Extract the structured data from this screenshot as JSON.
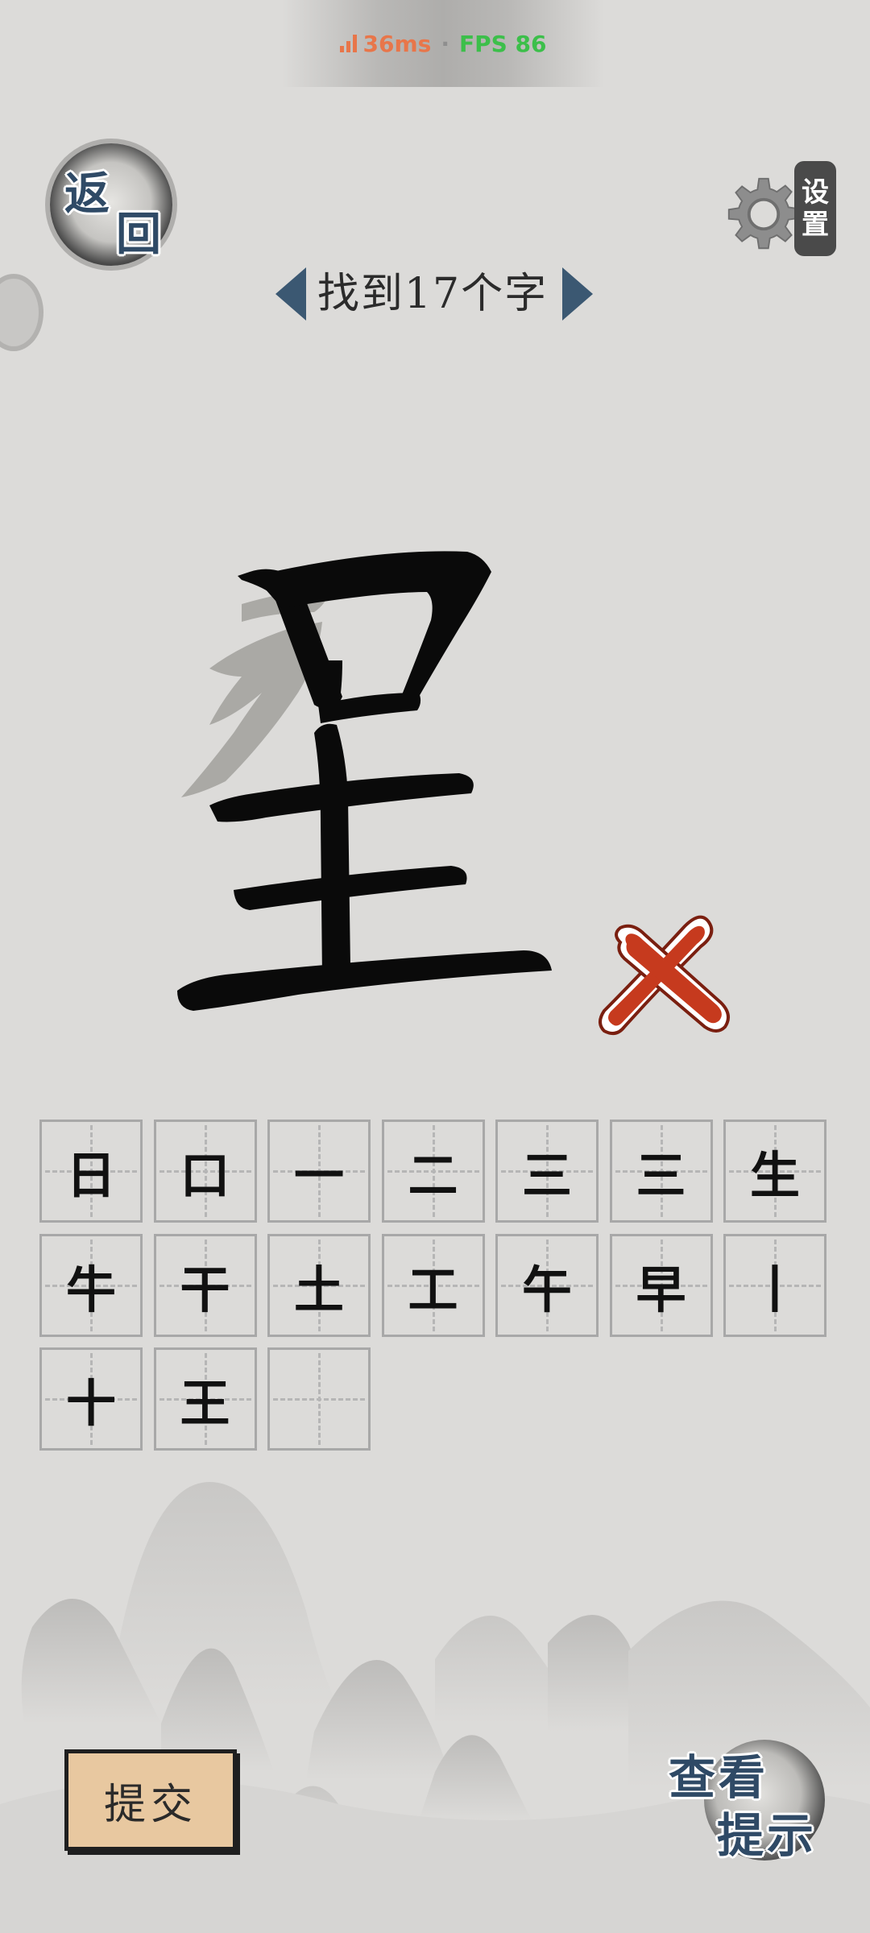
{
  "status_bar": {
    "latency": "36ms",
    "separator": "·",
    "fps": "FPS 86"
  },
  "back_button": {
    "line1": "返",
    "line2": "回"
  },
  "settings_button": {
    "line1": "设",
    "line2": "置"
  },
  "title": "找到17个字",
  "target_character": "星",
  "found_characters": [
    "日",
    "口",
    "一",
    "二",
    "三",
    "三",
    "生",
    "牛",
    "干",
    "土",
    "工",
    "午",
    "早",
    "丨",
    "十",
    "王",
    ""
  ],
  "submit_button": "提交",
  "hint_button": {
    "line1": "查看",
    "line2": "提示"
  },
  "colors": {
    "accent": "#3b5872",
    "wrong_mark": "#c63a1e",
    "submit_bg": "#e8c8a0"
  }
}
